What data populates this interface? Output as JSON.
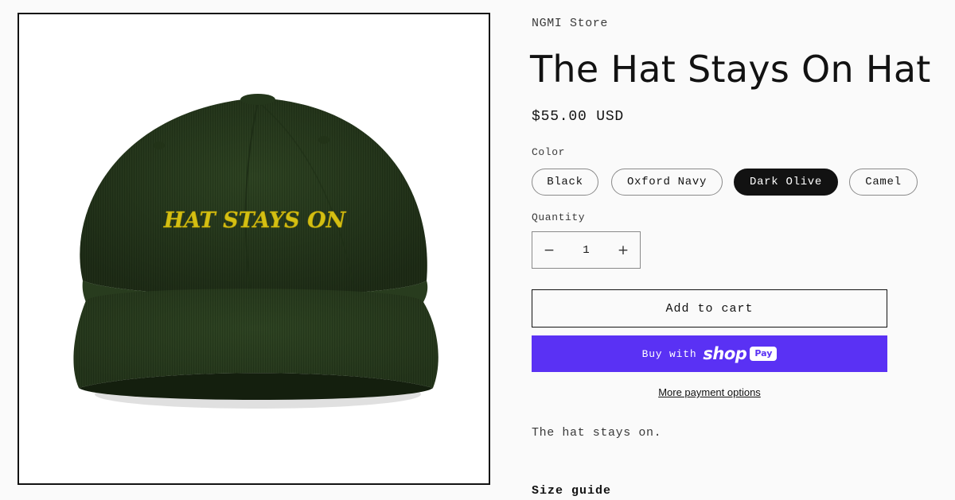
{
  "product": {
    "vendor": "NGMI Store",
    "title": "The Hat Stays On Hat",
    "price": "$55.00 USD",
    "image_text": "HAT STAYS ON",
    "image_colors": {
      "hat": "#2f4423",
      "embroidery": "#d4bf12"
    }
  },
  "variants": {
    "label": "Color",
    "options": [
      {
        "label": "Black",
        "selected": false
      },
      {
        "label": "Oxford Navy",
        "selected": false
      },
      {
        "label": "Dark Olive",
        "selected": true
      },
      {
        "label": "Camel",
        "selected": false
      }
    ]
  },
  "quantity": {
    "label": "Quantity",
    "value": "1",
    "decrement_icon": "minus-icon",
    "increment_icon": "plus-icon"
  },
  "actions": {
    "add_to_cart": "Add to cart",
    "shop_pay_prefix": "Buy with",
    "shop_pay_word": "shop",
    "shop_pay_badge": "Pay",
    "more_payment": "More payment options"
  },
  "description": "The hat stays on.",
  "size_guide": "Size guide",
  "colors": {
    "accent": "#5a31f4",
    "text": "#121212",
    "background": "#fafafa"
  }
}
